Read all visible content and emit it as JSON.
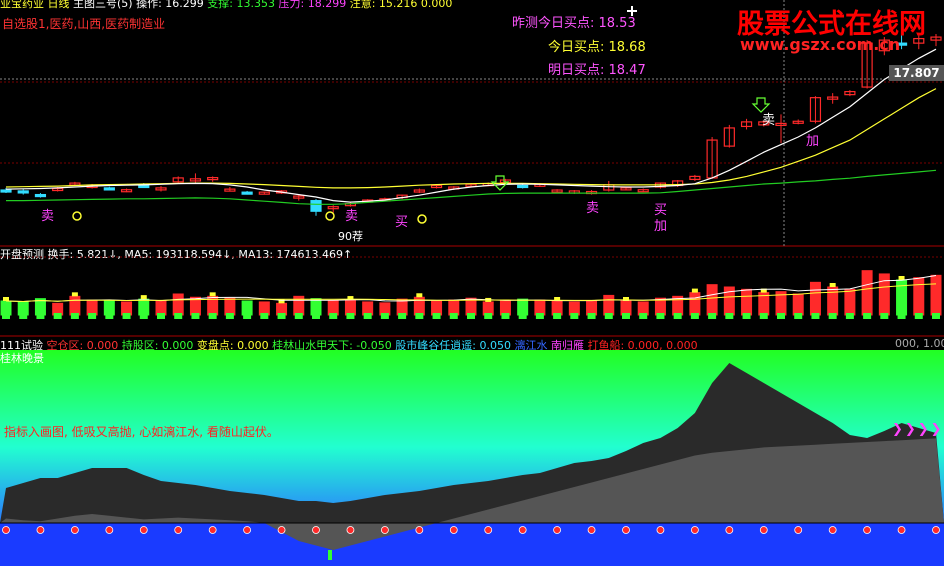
{
  "colors": {
    "up": "#ff2a2a",
    "down": "#33ddff",
    "ma_white": "#ffffff",
    "ma_yellow": "#ffff33",
    "ma_green": "#22cc22",
    "ma_red": "#ff3333",
    "grid": "#7a0000",
    "watermark": "#ff0000",
    "magenta": "#ff44ff"
  },
  "top_header": {
    "s1": "业宝药业 日线",
    "s2": "主图三号(5)",
    "s3": "操作: 16.299",
    "s4": "支撑: 13.353",
    "s5": "压力: 18.299",
    "s6": "注意: 15.216",
    "s7": "0.000"
  },
  "stock_tags": "自选股1,医药,山西,医药制造业",
  "buy_points": {
    "yesterday": "昨测今日买点: 18.53",
    "today": "今日买点: 18.68",
    "tomorrow": "明日买点: 18.47"
  },
  "watermark": {
    "title": "股票公式在线网",
    "url": "www.gszx.com.cn"
  },
  "price_label": "17.807",
  "signal_labels": {
    "sell1": "卖",
    "sell2": "卖",
    "sell3": "卖",
    "buy1": "买",
    "buy2": "买",
    "add1": "加",
    "add2": "加",
    "note": "90荐"
  },
  "vol_panel": {
    "name": "开盘预测",
    "turnover": "换手: 5.821↓",
    "ma5": "MA5: 193118.594↓",
    "ma13": "MA13: 174613.469↑"
  },
  "indicator_header": {
    "name": "111试验",
    "kc": "空仓区: 0.000",
    "cg": "持股区: 0.000",
    "bp": "变盘点: 0.000",
    "gl": "桂林山水甲天下: -0.050",
    "gs": "股市峰谷任逍遥: 0.050",
    "lj": "漓江水",
    "ny": "南归雁",
    "dy": "打鱼船: 0.000, 0.000",
    "tail": "000, 1.00"
  },
  "scene_title": "桂林晚景",
  "poem": "指标入画图, 低吸又高抛, 心如漓江水, 看随山起伏。",
  "birds": "❯❯❯❯",
  "chart_data": {
    "type": "candlestick",
    "candles": [
      [
        14.45,
        14.52,
        14.35,
        14.42
      ],
      [
        14.42,
        14.48,
        14.3,
        14.4
      ],
      [
        14.3,
        14.35,
        14.2,
        14.28
      ],
      [
        14.45,
        14.55,
        14.4,
        14.5
      ],
      [
        14.62,
        14.72,
        14.58,
        14.68
      ],
      [
        14.55,
        14.65,
        14.5,
        14.6
      ],
      [
        14.52,
        14.56,
        14.45,
        14.48
      ],
      [
        14.4,
        14.5,
        14.38,
        14.46
      ],
      [
        14.6,
        14.68,
        14.55,
        14.58
      ],
      [
        14.5,
        14.58,
        14.4,
        14.52
      ],
      [
        14.72,
        14.9,
        14.65,
        14.85
      ],
      [
        14.75,
        15.0,
        14.7,
        14.82
      ],
      [
        14.8,
        14.9,
        14.72,
        14.86
      ],
      [
        14.45,
        14.55,
        14.4,
        14.48
      ],
      [
        14.38,
        14.42,
        14.3,
        14.36
      ],
      [
        14.35,
        14.4,
        14.3,
        14.38
      ],
      [
        14.4,
        14.45,
        14.32,
        14.42
      ],
      [
        14.2,
        14.3,
        14.1,
        14.25
      ],
      [
        14.1,
        14.15,
        13.6,
        13.75
      ],
      [
        13.85,
        13.95,
        13.7,
        13.9
      ],
      [
        13.95,
        14.05,
        13.9,
        14.0
      ],
      [
        14.1,
        14.15,
        14.05,
        14.12
      ],
      [
        14.15,
        14.2,
        14.1,
        14.16
      ],
      [
        14.2,
        14.3,
        14.15,
        14.28
      ],
      [
        14.4,
        14.5,
        14.35,
        14.45
      ],
      [
        14.55,
        14.65,
        14.5,
        14.6
      ],
      [
        14.5,
        14.58,
        14.45,
        14.55
      ],
      [
        14.6,
        14.68,
        14.55,
        14.64
      ],
      [
        14.62,
        14.7,
        14.58,
        14.66
      ],
      [
        14.7,
        14.82,
        14.65,
        14.78
      ],
      [
        14.6,
        14.65,
        14.5,
        14.58
      ],
      [
        14.62,
        14.68,
        14.55,
        14.64
      ],
      [
        14.4,
        14.48,
        14.35,
        14.45
      ],
      [
        14.38,
        14.45,
        14.32,
        14.42
      ],
      [
        14.35,
        14.45,
        14.3,
        14.4
      ],
      [
        14.45,
        14.75,
        14.4,
        14.62
      ],
      [
        14.5,
        14.55,
        14.45,
        14.52
      ],
      [
        14.45,
        14.5,
        14.4,
        14.46
      ],
      [
        14.55,
        14.7,
        14.5,
        14.68
      ],
      [
        14.6,
        14.78,
        14.55,
        14.75
      ],
      [
        14.8,
        14.95,
        14.75,
        14.9
      ],
      [
        14.85,
        16.2,
        14.82,
        16.1
      ],
      [
        15.9,
        16.6,
        15.85,
        16.5
      ],
      [
        16.55,
        16.8,
        16.45,
        16.7
      ],
      [
        16.6,
        16.75,
        16.55,
        16.7
      ],
      [
        16.65,
        16.95,
        16.0,
        16.65
      ],
      [
        16.7,
        16.78,
        16.62,
        16.72
      ],
      [
        16.72,
        17.55,
        16.65,
        17.5
      ],
      [
        17.45,
        17.65,
        17.3,
        17.52
      ],
      [
        17.6,
        17.75,
        17.55,
        17.7
      ],
      [
        17.85,
        19.4,
        17.8,
        19.3
      ],
      [
        19.05,
        19.5,
        18.9,
        19.4
      ],
      [
        19.3,
        19.55,
        19.1,
        19.25
      ],
      [
        19.3,
        19.55,
        19.1,
        19.45
      ],
      [
        19.4,
        19.6,
        19.2,
        19.5
      ]
    ],
    "ma_white": [
      14.48,
      14.49,
      14.5,
      14.52,
      14.55,
      14.58,
      14.6,
      14.61,
      14.62,
      14.64,
      14.66,
      14.67,
      14.66,
      14.62,
      14.55,
      14.45,
      14.38,
      14.3,
      14.22,
      14.1,
      14.05,
      14.08,
      14.12,
      14.2,
      14.28,
      14.38,
      14.48,
      14.55,
      14.6,
      14.64,
      14.65,
      14.64,
      14.62,
      14.6,
      14.58,
      14.56,
      14.55,
      14.55,
      14.57,
      14.6,
      14.66,
      14.85,
      15.1,
      15.4,
      15.7,
      15.95,
      16.2,
      16.5,
      16.85,
      17.2,
      17.65,
      18.1,
      18.45,
      18.8,
      19.1
    ],
    "ma_yellow": [
      14.55,
      14.56,
      14.57,
      14.58,
      14.6,
      14.62,
      14.63,
      14.64,
      14.65,
      14.66,
      14.67,
      14.68,
      14.68,
      14.67,
      14.65,
      14.63,
      14.6,
      14.57,
      14.54,
      14.52,
      14.52,
      14.53,
      14.55,
      14.58,
      14.61,
      14.63,
      14.65,
      14.66,
      14.67,
      14.67,
      14.67,
      14.66,
      14.65,
      14.64,
      14.63,
      14.62,
      14.62,
      14.62,
      14.62,
      14.63,
      14.65,
      14.7,
      14.78,
      14.9,
      15.05,
      15.2,
      15.4,
      15.6,
      15.85,
      16.1,
      16.45,
      16.8,
      17.15,
      17.5,
      17.8
    ],
    "ma_green": [
      14.1,
      14.1,
      14.11,
      14.12,
      14.13,
      14.14,
      14.15,
      14.16,
      14.16,
      14.17,
      14.18,
      14.19,
      14.18,
      14.16,
      14.12,
      14.08,
      14.04,
      14.0,
      13.98,
      13.98,
      14.0,
      14.04,
      14.08,
      14.12,
      14.16,
      14.2,
      14.24,
      14.28,
      14.32,
      14.34,
      14.35,
      14.35,
      14.35,
      14.35,
      14.35,
      14.35,
      14.35,
      14.35,
      14.36,
      14.4,
      14.45,
      14.5,
      14.55,
      14.6,
      14.65,
      14.68,
      14.72,
      14.75,
      14.8,
      14.84,
      14.9,
      14.95,
      15.0,
      15.05,
      15.1
    ],
    "ylim": [
      12.8,
      19.8
    ],
    "volume": [
      30,
      28,
      35,
      25,
      40,
      32,
      30,
      28,
      34,
      30,
      45,
      38,
      40,
      36,
      30,
      28,
      25,
      40,
      35,
      30,
      32,
      28,
      26,
      34,
      38,
      30,
      32,
      36,
      28,
      30,
      34,
      32,
      30,
      28,
      30,
      42,
      30,
      28,
      36,
      40,
      48,
      65,
      60,
      55,
      48,
      50,
      45,
      70,
      60,
      55,
      95,
      88,
      75,
      80,
      85
    ],
    "vol_ylim": [
      0,
      120
    ],
    "bg_upper_mountain": [
      35,
      40,
      45,
      45,
      50,
      55,
      55,
      55,
      48,
      42,
      40,
      38,
      35,
      32,
      30,
      28,
      25,
      22,
      22,
      20,
      22,
      25,
      28,
      30,
      32,
      35,
      38,
      40,
      42,
      45,
      48,
      50,
      55,
      60,
      62,
      65,
      72,
      80,
      85,
      95,
      110,
      140,
      160,
      150,
      140,
      130,
      120,
      110,
      100,
      88,
      85,
      92,
      100,
      95,
      90
    ],
    "bg_lower_mountain": [
      5,
      3,
      2,
      5,
      8,
      10,
      8,
      6,
      4,
      5,
      6,
      5,
      4,
      3,
      2,
      0,
      -10,
      -20,
      -25,
      -30,
      -25,
      -20,
      -15,
      -10,
      -5,
      0,
      5,
      10,
      15,
      20,
      25,
      30,
      35,
      40,
      45,
      50,
      55,
      60,
      65,
      70,
      75,
      78,
      80,
      82,
      84,
      85,
      86,
      87,
      88,
      89,
      90,
      91,
      92,
      93,
      94
    ]
  }
}
